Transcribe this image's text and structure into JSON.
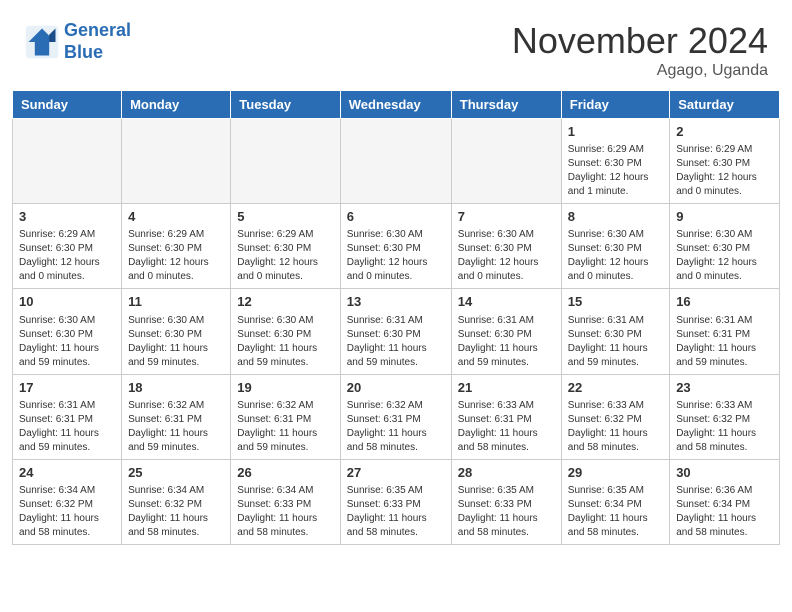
{
  "header": {
    "logo_line1": "General",
    "logo_line2": "Blue",
    "month_title": "November 2024",
    "location": "Agago, Uganda"
  },
  "days_of_week": [
    "Sunday",
    "Monday",
    "Tuesday",
    "Wednesday",
    "Thursday",
    "Friday",
    "Saturday"
  ],
  "weeks": [
    [
      {
        "day": "",
        "empty": true
      },
      {
        "day": "",
        "empty": true
      },
      {
        "day": "",
        "empty": true
      },
      {
        "day": "",
        "empty": true
      },
      {
        "day": "",
        "empty": true
      },
      {
        "day": "1",
        "sunrise": "6:29 AM",
        "sunset": "6:30 PM",
        "daylight": "12 hours and 1 minute."
      },
      {
        "day": "2",
        "sunrise": "6:29 AM",
        "sunset": "6:30 PM",
        "daylight": "12 hours and 0 minutes."
      }
    ],
    [
      {
        "day": "3",
        "sunrise": "6:29 AM",
        "sunset": "6:30 PM",
        "daylight": "12 hours and 0 minutes."
      },
      {
        "day": "4",
        "sunrise": "6:29 AM",
        "sunset": "6:30 PM",
        "daylight": "12 hours and 0 minutes."
      },
      {
        "day": "5",
        "sunrise": "6:29 AM",
        "sunset": "6:30 PM",
        "daylight": "12 hours and 0 minutes."
      },
      {
        "day": "6",
        "sunrise": "6:30 AM",
        "sunset": "6:30 PM",
        "daylight": "12 hours and 0 minutes."
      },
      {
        "day": "7",
        "sunrise": "6:30 AM",
        "sunset": "6:30 PM",
        "daylight": "12 hours and 0 minutes."
      },
      {
        "day": "8",
        "sunrise": "6:30 AM",
        "sunset": "6:30 PM",
        "daylight": "12 hours and 0 minutes."
      },
      {
        "day": "9",
        "sunrise": "6:30 AM",
        "sunset": "6:30 PM",
        "daylight": "12 hours and 0 minutes."
      }
    ],
    [
      {
        "day": "10",
        "sunrise": "6:30 AM",
        "sunset": "6:30 PM",
        "daylight": "11 hours and 59 minutes."
      },
      {
        "day": "11",
        "sunrise": "6:30 AM",
        "sunset": "6:30 PM",
        "daylight": "11 hours and 59 minutes."
      },
      {
        "day": "12",
        "sunrise": "6:30 AM",
        "sunset": "6:30 PM",
        "daylight": "11 hours and 59 minutes."
      },
      {
        "day": "13",
        "sunrise": "6:31 AM",
        "sunset": "6:30 PM",
        "daylight": "11 hours and 59 minutes."
      },
      {
        "day": "14",
        "sunrise": "6:31 AM",
        "sunset": "6:30 PM",
        "daylight": "11 hours and 59 minutes."
      },
      {
        "day": "15",
        "sunrise": "6:31 AM",
        "sunset": "6:30 PM",
        "daylight": "11 hours and 59 minutes."
      },
      {
        "day": "16",
        "sunrise": "6:31 AM",
        "sunset": "6:31 PM",
        "daylight": "11 hours and 59 minutes."
      }
    ],
    [
      {
        "day": "17",
        "sunrise": "6:31 AM",
        "sunset": "6:31 PM",
        "daylight": "11 hours and 59 minutes."
      },
      {
        "day": "18",
        "sunrise": "6:32 AM",
        "sunset": "6:31 PM",
        "daylight": "11 hours and 59 minutes."
      },
      {
        "day": "19",
        "sunrise": "6:32 AM",
        "sunset": "6:31 PM",
        "daylight": "11 hours and 59 minutes."
      },
      {
        "day": "20",
        "sunrise": "6:32 AM",
        "sunset": "6:31 PM",
        "daylight": "11 hours and 58 minutes."
      },
      {
        "day": "21",
        "sunrise": "6:33 AM",
        "sunset": "6:31 PM",
        "daylight": "11 hours and 58 minutes."
      },
      {
        "day": "22",
        "sunrise": "6:33 AM",
        "sunset": "6:32 PM",
        "daylight": "11 hours and 58 minutes."
      },
      {
        "day": "23",
        "sunrise": "6:33 AM",
        "sunset": "6:32 PM",
        "daylight": "11 hours and 58 minutes."
      }
    ],
    [
      {
        "day": "24",
        "sunrise": "6:34 AM",
        "sunset": "6:32 PM",
        "daylight": "11 hours and 58 minutes."
      },
      {
        "day": "25",
        "sunrise": "6:34 AM",
        "sunset": "6:32 PM",
        "daylight": "11 hours and 58 minutes."
      },
      {
        "day": "26",
        "sunrise": "6:34 AM",
        "sunset": "6:33 PM",
        "daylight": "11 hours and 58 minutes."
      },
      {
        "day": "27",
        "sunrise": "6:35 AM",
        "sunset": "6:33 PM",
        "daylight": "11 hours and 58 minutes."
      },
      {
        "day": "28",
        "sunrise": "6:35 AM",
        "sunset": "6:33 PM",
        "daylight": "11 hours and 58 minutes."
      },
      {
        "day": "29",
        "sunrise": "6:35 AM",
        "sunset": "6:34 PM",
        "daylight": "11 hours and 58 minutes."
      },
      {
        "day": "30",
        "sunrise": "6:36 AM",
        "sunset": "6:34 PM",
        "daylight": "11 hours and 58 minutes."
      }
    ]
  ]
}
